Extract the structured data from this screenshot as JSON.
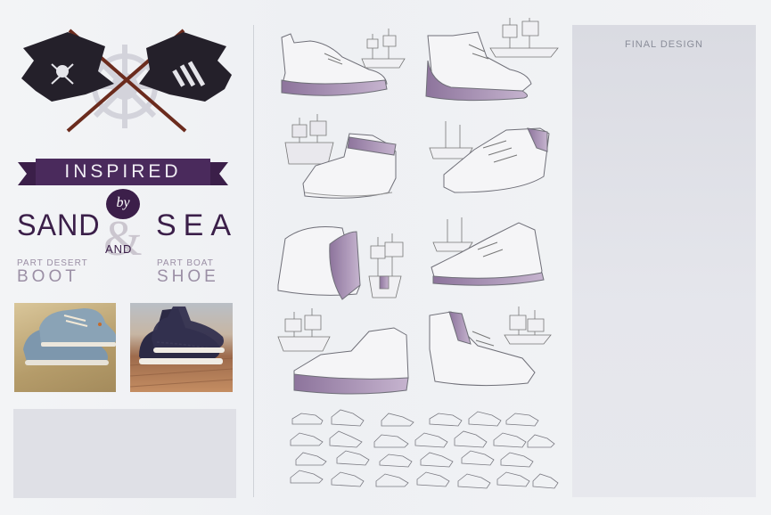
{
  "header": {
    "ribbon_text": "INSPIRED",
    "by_text": "by"
  },
  "title": {
    "left_word": "SAND",
    "right_word": "SEA",
    "ampersand": "&",
    "and_text": "AND",
    "left_sub_small": "PART DESERT",
    "left_sub_big": "BOOT",
    "right_sub_small": "PART BOAT",
    "right_sub_big": "SHOE"
  },
  "right_panel": {
    "label": "FINAL DESIGN"
  },
  "colors": {
    "accent": "#3b1f49",
    "purple_sole": "#9b82a8",
    "muted": "#9b8fa5",
    "panel": "#dfe0e6"
  },
  "icons": [
    "ship-wheel-icon",
    "pirate-flag-icon",
    "adidas-flag-icon",
    "sailing-ship-icon",
    "shoe-sketch-icon"
  ]
}
